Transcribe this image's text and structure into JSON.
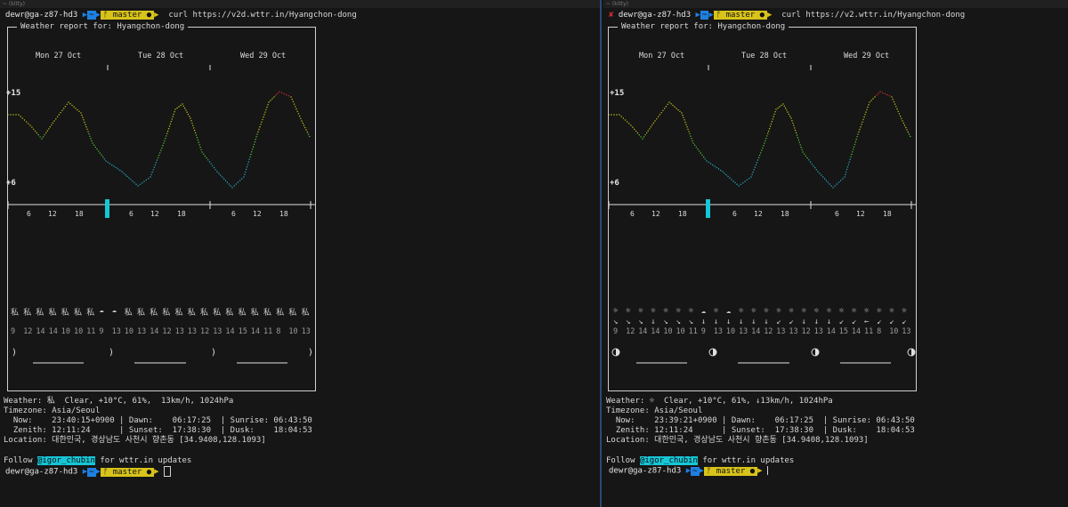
{
  "left": {
    "title": "~ (kitty)",
    "prompt": {
      "user": "dewr@ga-z87-hd3",
      "dir": "~",
      "branch": "master",
      "command": "curl https://v2d.wttr.in/Hyangchon-dong"
    },
    "report_title": "Weather report for: Hyangchon-dong",
    "days": [
      "Mon 27 Oct",
      "Tue 28 Oct",
      "Wed 29 Oct"
    ],
    "ylabels": {
      "top": "+15",
      "bottom": "+6"
    },
    "hours": [
      "6",
      "12",
      "18",
      "6",
      "12",
      "18",
      "6",
      "12",
      "18"
    ],
    "temps": [
      "9",
      "12",
      "14",
      "14",
      "10",
      "10",
      "11",
      "9",
      "13",
      "10",
      "13",
      "14",
      "12",
      "13",
      "13",
      "12",
      "13",
      "14",
      "15",
      "14",
      "11",
      "8",
      "10",
      "13"
    ],
    "weather_icon": "私",
    "weather_line": "Clear, +10°C, 61%,  13km/h, 1024hPa",
    "weather_label": "Weather:",
    "timezone_label": "Timezone:",
    "timezone": "Asia/Seoul",
    "now": "  Now:    23:40:15+0900 | Dawn:    06:17:25  | Sunrise: 06:43:50",
    "zenith": "  Zenith: 12:11:24      | Sunset:  17:38:30  | Dusk:    18:04:53",
    "location": "Location: 대한민국, 경상남도 사천시 향촌동 [34.9408,128.1093]",
    "follow_pre": "Follow ",
    "follow_handle": "@igor_chubin",
    "follow_post": " for wttr.in updates",
    "prompt2": {
      "user": "dewr@ga-z87-hd3",
      "dir": "~",
      "branch": "master"
    }
  },
  "right": {
    "title": "~ (kitty)",
    "prompt": {
      "user": "dewr@ga-z87-hd3",
      "dir": "~",
      "branch": "master",
      "command": "curl https://v2.wttr.in/Hyangchon-dong"
    },
    "report_title": "Weather report for: Hyangchon-dong",
    "days": [
      "Mon 27 Oct",
      "Tue 28 Oct",
      "Wed 29 Oct"
    ],
    "ylabels": {
      "top": "+15",
      "bottom": "+6"
    },
    "hours": [
      "6",
      "12",
      "18",
      "6",
      "12",
      "18",
      "6",
      "12",
      "18"
    ],
    "temps": [
      "9",
      "12",
      "14",
      "14",
      "10",
      "10",
      "11",
      "9",
      "13",
      "10",
      "13",
      "14",
      "12",
      "13",
      "13",
      "12",
      "13",
      "14",
      "15",
      "14",
      "11",
      "8",
      "10",
      "13"
    ],
    "weather_icon": "☼",
    "weather_line": "Clear, +10°C, 61%, ↓13km/h, 1024hPa",
    "weather_label": "Weather:",
    "timezone_label": "Timezone:",
    "timezone": "Asia/Seoul",
    "now": "  Now:    23:39:21+0900 | Dawn:    06:17:25  | Sunrise: 06:43:50",
    "zenith": "  Zenith: 12:11:24      | Sunset:  17:38:30  | Dusk:    18:04:53",
    "location": "Location: 대한민국, 경상남도 사천시 향촌동 [34.9408,128.1093]",
    "follow_pre": "Follow ",
    "follow_handle": "@igor_chubin",
    "follow_post": " for wttr.in updates",
    "prompt2": {
      "user": "dewr@ga-z87-hd3",
      "dir": "~",
      "branch": "master"
    }
  },
  "colors": {
    "prompt_blue": "#1e7fe0",
    "prompt_yellow": "#d8c31a",
    "highlight": "#16c6d6",
    "border_active": "#2b4a70"
  }
}
